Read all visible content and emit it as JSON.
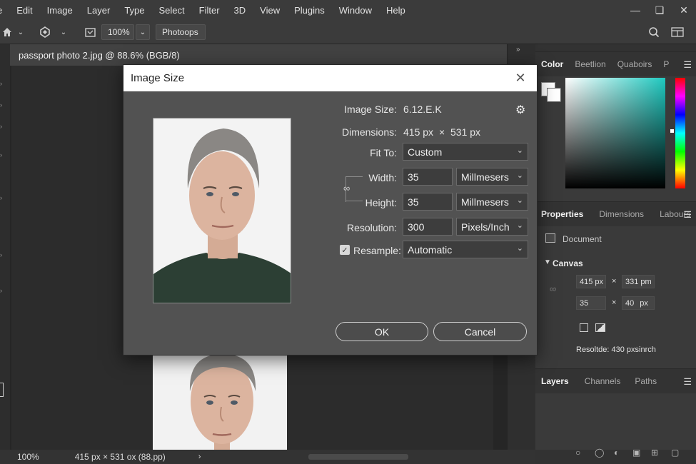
{
  "menubar": {
    "items": [
      "e",
      "Edit",
      "Image",
      "Layer",
      "Type",
      "Select",
      "Filter",
      "3D",
      "View",
      "Plugins",
      "Window",
      "Help"
    ],
    "window_controls": [
      "minimize-icon",
      "maximize-icon",
      "close-icon"
    ]
  },
  "optionsbar": {
    "zoom": "100%",
    "workspace": "Photoops"
  },
  "document": {
    "tab_title": "passport photo 2.jpg @ 88.6% (BGB/8)"
  },
  "dialog": {
    "title": "Image Size",
    "image_size_label": "Image Size:",
    "image_size_value": "6.12.E.K",
    "dimensions_label": "Dimensions:",
    "dimensions_w": "415 px",
    "dimensions_x": "×",
    "dimensions_h": "531 px",
    "fit_to_label": "Fit To:",
    "fit_to_value": "Custom",
    "width_label": "Width:",
    "width_value": "35",
    "width_unit": "Millmesers",
    "height_label": "Height:",
    "height_value": "35",
    "height_unit": "Millmesers",
    "resolution_label": "Resolution:",
    "resolution_value": "300",
    "resolution_unit": "Pixels/Inch",
    "resample_label": "Resample:",
    "resample_checked": true,
    "resample_value": "Automatic",
    "ok_label": "OK",
    "cancel_label": "Cancel"
  },
  "color_panel": {
    "tabs": [
      "Color",
      "Beetlion",
      "Quaboirs",
      "P"
    ]
  },
  "properties_panel": {
    "tabs": [
      "Properties",
      "Dimensions",
      "Labours"
    ],
    "document_label": "Document",
    "canvas_label": "Canvas",
    "canvas_w": "415 px",
    "canvas_h": "331 pm",
    "canvas_x1": "×",
    "size_w": "35",
    "size_h_num": "40",
    "size_h_unit": "px",
    "canvas_x2": "×",
    "resolution_text": "Resoltde: 430 pxsinrch"
  },
  "layers_panel": {
    "tabs": [
      "Layers",
      "Channels",
      "Paths"
    ]
  },
  "statusbar": {
    "zoom": "100%",
    "info": "415 px × 531 ox (88.pp)"
  }
}
